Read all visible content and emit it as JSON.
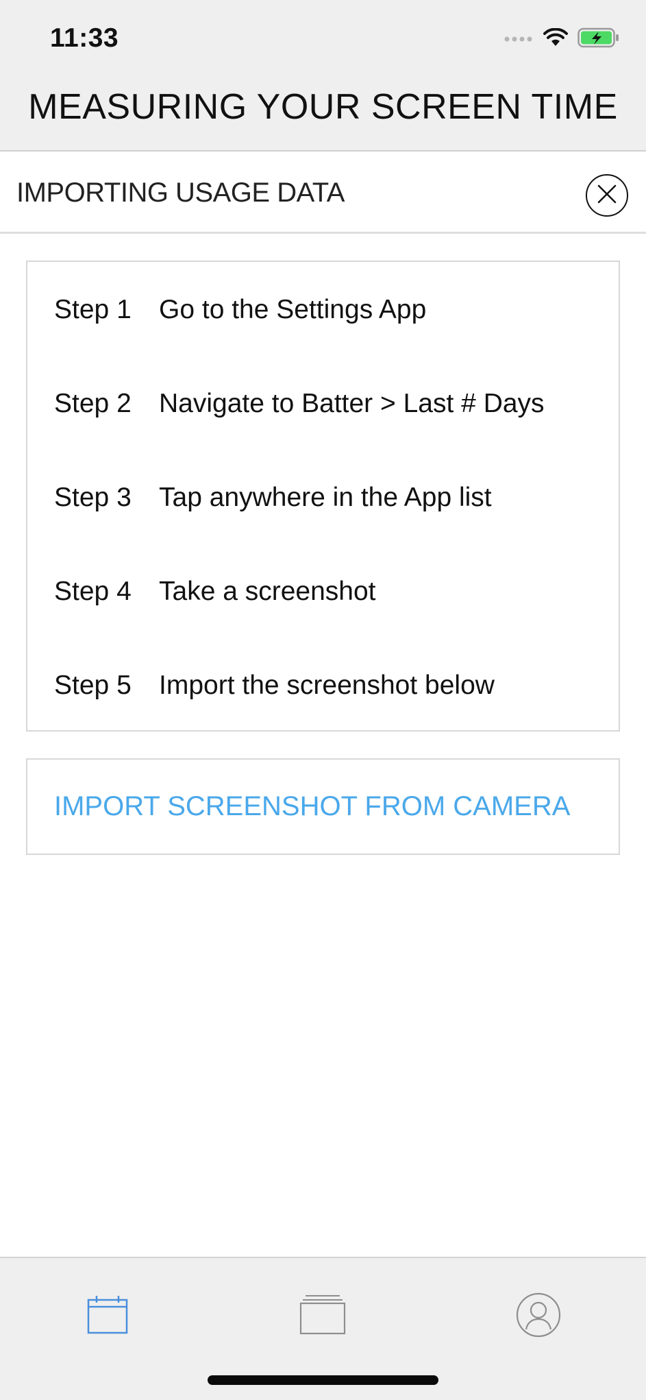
{
  "status_bar": {
    "time": "11:33"
  },
  "header": {
    "title": "MEASURING YOUR SCREEN TIME"
  },
  "section": {
    "title": "IMPORTING USAGE DATA",
    "close_icon": "close-circle-icon"
  },
  "steps": [
    {
      "label": "Step 1",
      "text": "Go to the Settings App"
    },
    {
      "label": "Step 2",
      "text": "Navigate to Batter > Last # Days"
    },
    {
      "label": "Step 3",
      "text": "Tap anywhere in the App list"
    },
    {
      "label": "Step 4",
      "text": "Take a screenshot"
    },
    {
      "label": "Step 5",
      "text": "Import the screenshot below"
    }
  ],
  "import_button": {
    "label": "IMPORT SCREENSHOT FROM CAMERA"
  },
  "tab_bar": {
    "tabs": [
      {
        "icon": "calendar-icon",
        "selected": true
      },
      {
        "icon": "stack-icon",
        "selected": false
      },
      {
        "icon": "profile-icon",
        "selected": false
      }
    ]
  },
  "colors": {
    "accent": "#4aa8ea",
    "tab_selected": "#4a8fdc",
    "tab_unselected": "#8e8e8e",
    "header_bg": "#efefef",
    "battery_green": "#4cd964"
  }
}
